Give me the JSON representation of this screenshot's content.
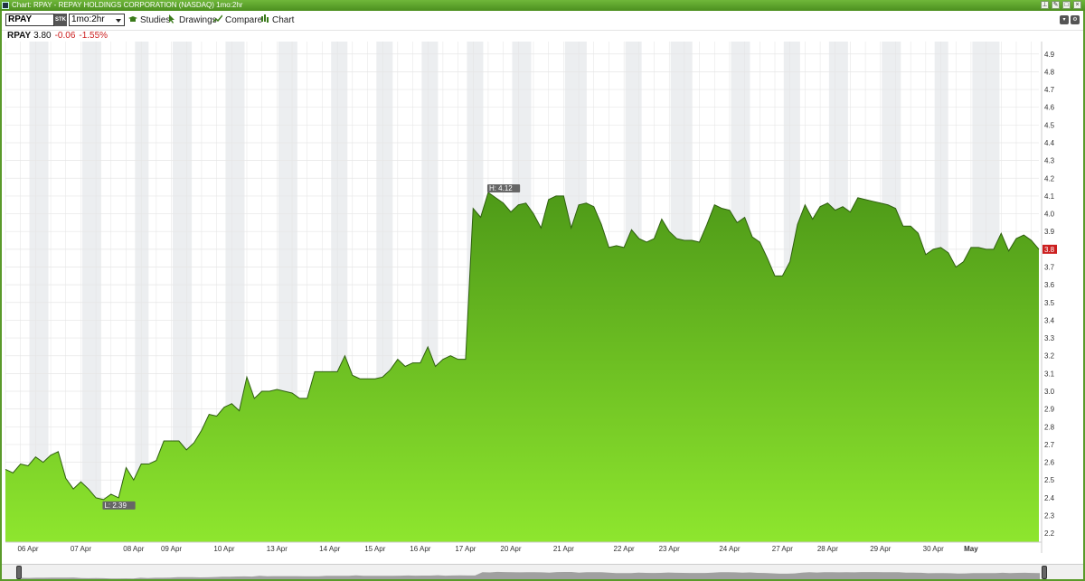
{
  "window": {
    "title": "Chart: RPAY - REPAY HOLDINGS CORPORATION (NASDAQ) 1mo:2hr",
    "buttons": [
      "pin-icon",
      "edit-icon",
      "restore-icon",
      "close-icon"
    ]
  },
  "toolbar": {
    "symbol": "RPAY",
    "symbol_type": "STK",
    "period": "1mo:2hr",
    "studies": "Studies",
    "drawings": "Drawings",
    "compare": "Compare",
    "chart": "Chart",
    "right_buttons": [
      "dropdown-icon",
      "settings-icon"
    ]
  },
  "quote": {
    "symbol": "RPAY",
    "price": "3.80",
    "change": "-0.06",
    "percent": "-1.55%"
  },
  "colors": {
    "fill_top": "#4e9a18",
    "fill_bottom": "#8ee62e",
    "line": "#2f5f10",
    "current_tag": "#cc1f1f"
  },
  "chart_data": {
    "type": "area",
    "title": "",
    "xlabel": "",
    "ylabel": "",
    "ylim": [
      2.15,
      4.97
    ],
    "y_ticks": [
      "2.2",
      "2.3",
      "2.4",
      "2.5",
      "2.6",
      "2.7",
      "2.8",
      "2.9",
      "3.0",
      "3.1",
      "3.2",
      "3.3",
      "3.4",
      "3.5",
      "3.6",
      "3.7",
      "3.8",
      "3.9",
      "4.0",
      "4.1",
      "4.2",
      "4.3",
      "4.4",
      "4.5",
      "4.6",
      "4.7",
      "4.8",
      "4.9"
    ],
    "x_labels": [
      {
        "label": "06 Apr",
        "bar": 3
      },
      {
        "label": "07 Apr",
        "bar": 10
      },
      {
        "label": "08 Apr",
        "bar": 17
      },
      {
        "label": "09 Apr",
        "bar": 22
      },
      {
        "label": "10 Apr",
        "bar": 29
      },
      {
        "label": "13 Apr",
        "bar": 36
      },
      {
        "label": "14 Apr",
        "bar": 43
      },
      {
        "label": "15 Apr",
        "bar": 49
      },
      {
        "label": "16 Apr",
        "bar": 55
      },
      {
        "label": "17 Apr",
        "bar": 61
      },
      {
        "label": "20 Apr",
        "bar": 67
      },
      {
        "label": "21 Apr",
        "bar": 74
      },
      {
        "label": "22 Apr",
        "bar": 82
      },
      {
        "label": "23 Apr",
        "bar": 88
      },
      {
        "label": "24 Apr",
        "bar": 96
      },
      {
        "label": "27 Apr",
        "bar": 103
      },
      {
        "label": "28 Apr",
        "bar": 109
      },
      {
        "label": "29 Apr",
        "bar": 116
      },
      {
        "label": "30 Apr",
        "bar": 123
      },
      {
        "label": "May",
        "bar": 128
      }
    ],
    "series": [
      {
        "values": [
          2.56,
          2.54,
          2.59,
          2.58,
          2.63,
          2.6,
          2.64,
          2.66,
          2.51,
          2.45,
          2.49,
          2.45,
          2.4,
          2.39,
          2.42,
          2.4,
          2.57,
          2.5,
          2.59,
          2.59,
          2.61,
          2.72,
          2.72,
          2.72,
          2.67,
          2.71,
          2.78,
          2.87,
          2.86,
          2.91,
          2.93,
          2.89,
          3.08,
          2.96,
          3.0,
          3.0,
          3.01,
          3.0,
          2.99,
          2.96,
          2.96,
          3.11,
          3.11,
          3.11,
          3.11,
          3.2,
          3.09,
          3.07,
          3.07,
          3.07,
          3.08,
          3.12,
          3.18,
          3.14,
          3.16,
          3.16,
          3.25,
          3.14,
          3.18,
          3.2,
          3.18,
          3.18,
          4.03,
          3.98,
          4.12,
          4.09,
          4.06,
          4.01,
          4.05,
          4.06,
          4.0,
          3.92,
          4.08,
          4.1,
          4.1,
          3.92,
          4.05,
          4.06,
          4.04,
          3.94,
          3.81,
          3.82,
          3.81,
          3.91,
          3.86,
          3.84,
          3.86,
          3.97,
          3.9,
          3.86,
          3.85,
          3.85,
          3.84,
          3.94,
          4.05,
          4.03,
          4.02,
          3.95,
          3.98,
          3.87,
          3.84,
          3.75,
          3.65,
          3.65,
          3.73,
          3.94,
          4.05,
          3.97,
          4.04,
          4.06,
          4.02,
          4.04,
          4.01,
          4.09,
          4.08,
          4.07,
          4.06,
          4.05,
          4.03,
          3.93,
          3.93,
          3.89,
          3.77,
          3.8,
          3.81,
          3.78,
          3.7,
          3.73,
          3.81,
          3.81,
          3.8,
          3.8,
          3.89,
          3.79,
          3.86,
          3.88,
          3.85,
          3.8
        ]
      }
    ],
    "high_label": "H: 4.12",
    "high_index": 64,
    "low_label": "L: 2.39",
    "low_index": 13,
    "current_label": "3.8",
    "grid": true,
    "legend": "none"
  }
}
